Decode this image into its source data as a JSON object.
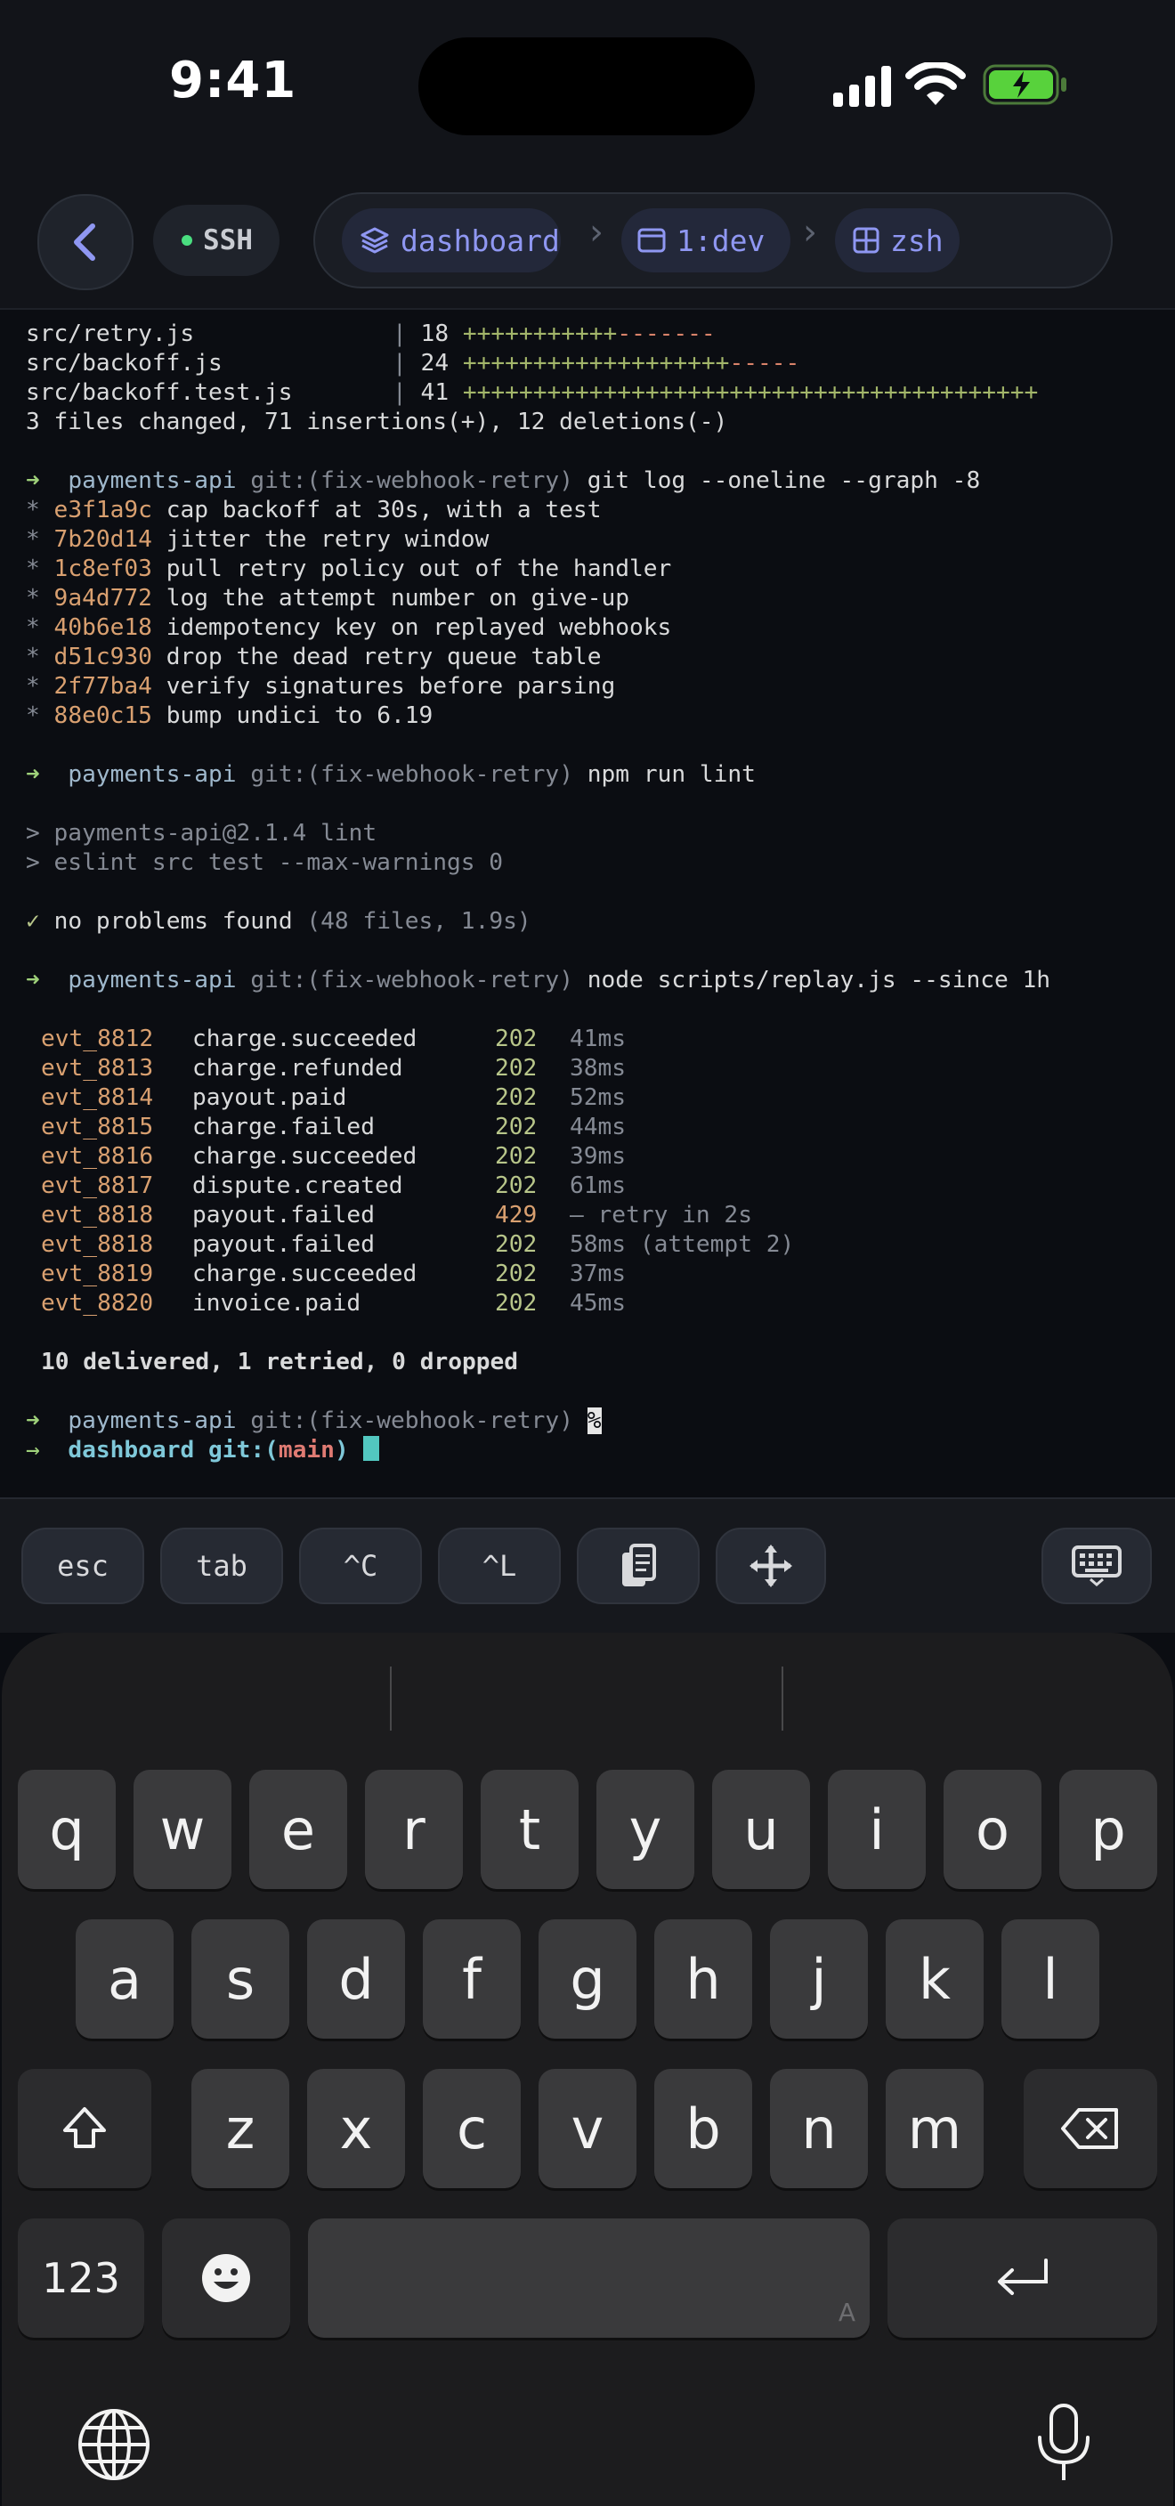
{
  "status": {
    "time": "9:41",
    "signal": "signal-bars-icon",
    "wifi": "wifi-icon",
    "battery": "battery-charging-icon"
  },
  "header": {
    "connection_label": "SSH",
    "breadcrumbs": [
      {
        "label": "dashboard",
        "icon": "layers-icon"
      },
      {
        "label": "1:dev",
        "icon": "window-icon"
      },
      {
        "label": "zsh",
        "icon": "grid-icon"
      }
    ]
  },
  "terminal": {
    "diffstat": [
      {
        "file": "src/retry.js",
        "count": "18",
        "plus": "+++++++++++",
        "minus": "-------"
      },
      {
        "file": "src/backoff.js",
        "count": "24",
        "plus": "+++++++++++++++++++",
        "minus": "-----"
      },
      {
        "file": "src/backoff.test.js",
        "count": "41",
        "plus": "+++++++++++++++++++++++++++++++++++++++++",
        "minus": ""
      }
    ],
    "diff_summary": "3 files changed, 71 insertions(+), 12 deletions(-)",
    "prompt_dir": "payments-api",
    "prompt_git_prefix": "git:(",
    "prompt_branch": "fix-webhook-retry",
    "prompt_git_suffix": ")",
    "cmd_log": "git log --oneline --graph -8",
    "commits": [
      {
        "hash": "e3f1a9c",
        "msg": "cap backoff at 30s, with a test"
      },
      {
        "hash": "7b20d14",
        "msg": "jitter the retry window"
      },
      {
        "hash": "1c8ef03",
        "msg": "pull retry policy out of the handler"
      },
      {
        "hash": "9a4d772",
        "msg": "log the attempt number on give-up"
      },
      {
        "hash": "40b6e18",
        "msg": "idempotency key on replayed webhooks"
      },
      {
        "hash": "d51c930",
        "msg": "drop the dead retry queue table"
      },
      {
        "hash": "2f77ba4",
        "msg": "verify signatures before parsing"
      },
      {
        "hash": "88e0c15",
        "msg": "bump undici to 6.19"
      }
    ],
    "cmd_lint": "npm run lint",
    "lint_out1": "> payments-api@2.1.4 lint",
    "lint_out2": "> eslint src test --max-warnings 0",
    "lint_result": "no problems found",
    "lint_detail": "(48 files, 1.9s)",
    "cmd_replay": "node scripts/replay.js --since 1h",
    "events": [
      {
        "id": "evt_8812",
        "type": "charge.succeeded",
        "code": "202",
        "note": "41ms"
      },
      {
        "id": "evt_8813",
        "type": "charge.refunded",
        "code": "202",
        "note": "38ms"
      },
      {
        "id": "evt_8814",
        "type": "payout.paid",
        "code": "202",
        "note": "52ms"
      },
      {
        "id": "evt_8815",
        "type": "charge.failed",
        "code": "202",
        "note": "44ms"
      },
      {
        "id": "evt_8816",
        "type": "charge.succeeded",
        "code": "202",
        "note": "39ms"
      },
      {
        "id": "evt_8817",
        "type": "dispute.created",
        "code": "202",
        "note": "61ms"
      },
      {
        "id": "evt_8818",
        "type": "payout.failed",
        "code": "429",
        "note": "— retry in 2s"
      },
      {
        "id": "evt_8818",
        "type": "payout.failed",
        "code": "202",
        "note": "58ms (attempt 2)"
      },
      {
        "id": "evt_8819",
        "type": "charge.succeeded",
        "code": "202",
        "note": "37ms"
      },
      {
        "id": "evt_8820",
        "type": "invoice.paid",
        "code": "202",
        "note": "45ms"
      }
    ],
    "replay_summary": "10 delivered, 1 retried, 0 dropped",
    "partial_marker": "%",
    "final_dir": "dashboard",
    "final_branch": "main"
  },
  "accessory": {
    "keys": [
      "esc",
      "tab",
      "^C",
      "^L"
    ],
    "icons": [
      "clipboard-icon",
      "move-icon",
      "keyboard-icon"
    ]
  },
  "keyboard": {
    "row1": [
      "q",
      "w",
      "e",
      "r",
      "t",
      "y",
      "u",
      "i",
      "o",
      "p"
    ],
    "row2": [
      "a",
      "s",
      "d",
      "f",
      "g",
      "h",
      "j",
      "k",
      "l"
    ],
    "row3": [
      "z",
      "x",
      "c",
      "v",
      "b",
      "n",
      "m"
    ],
    "numbers_label": "123",
    "space_hint": "A"
  }
}
